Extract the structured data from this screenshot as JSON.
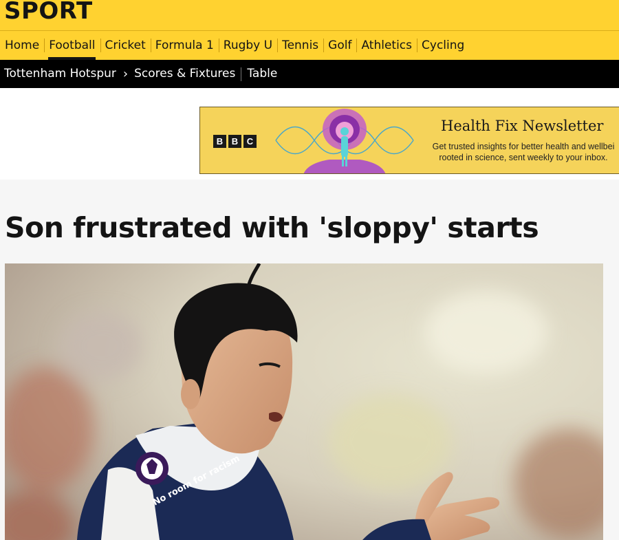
{
  "header": {
    "title": "SPORT",
    "nav": [
      "Home",
      "Football",
      "Cricket",
      "Formula 1",
      "Rugby U",
      "Tennis",
      "Golf",
      "Athletics",
      "Cycling"
    ],
    "active": "Football"
  },
  "subnav": {
    "team": "Tottenham Hotspur",
    "links": [
      "Scores & Fixtures",
      "Table"
    ]
  },
  "ad": {
    "logo_letters": [
      "B",
      "B",
      "C"
    ],
    "title": "Health Fix Newsletter",
    "line1": "Get trusted insights for better health and wellbei",
    "line2": "rooted in science, sent weekly to your inbox."
  },
  "article": {
    "headline": "Son frustrated with 'sloppy' starts",
    "photo_badge_text": "No room for racism"
  },
  "colors": {
    "header_yellow": "#ffd230",
    "subnav_black": "#000000",
    "ad_yellow": "#f5d35a",
    "kit_navy": "#1b2a55"
  }
}
